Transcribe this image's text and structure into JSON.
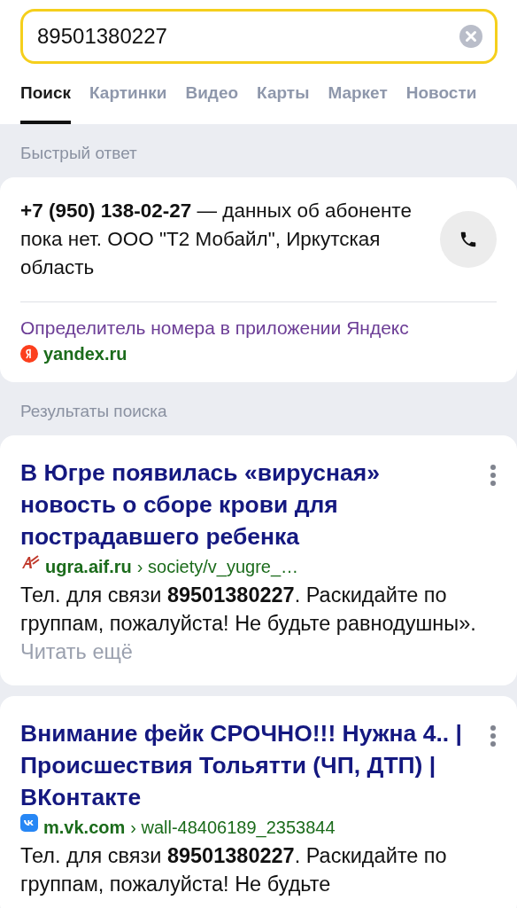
{
  "search": {
    "value": "89501380227"
  },
  "tabs": [
    {
      "label": "Поиск",
      "selected": true
    },
    {
      "label": "Картинки",
      "selected": false
    },
    {
      "label": "Видео",
      "selected": false
    },
    {
      "label": "Карты",
      "selected": false
    },
    {
      "label": "Маркет",
      "selected": false
    },
    {
      "label": "Новости",
      "selected": false
    }
  ],
  "quick_answer": {
    "heading": "Быстрый ответ",
    "text": "**+7 (950) 138-02-27** — данных об абоненте пока нет. ООО \"Т2 Мобайл\", Иркутская область",
    "link": "Определитель номера в приложении Яндекс",
    "source": "yandex.ru"
  },
  "results_heading": "Результаты поиска",
  "results": [
    {
      "kind": "aif",
      "title": "В Югре появилась «вирусная» новость о сборе крови для пострадавшего ребенка",
      "domain": "ugra.aif.ru",
      "path": "› society/v_yugre_…",
      "snippet": "Тел. для связи **89501380227**. Раскидайте по группам, пожалуйста! Не будьте равнодушны».",
      "more": "Читать ещё"
    },
    {
      "kind": "vk",
      "title": "Внимание фейк СРОЧНО!!! Нужна 4.. | Происшествия Тольятти (ЧП, ДТП) | ВКонтакте",
      "domain": "m.vk.com",
      "path": "› wall-48406189_2353844",
      "snippet": "Тел. для связи **89501380227**. Раскидайте по группам, пожалуйста! Не будьте"
    }
  ]
}
